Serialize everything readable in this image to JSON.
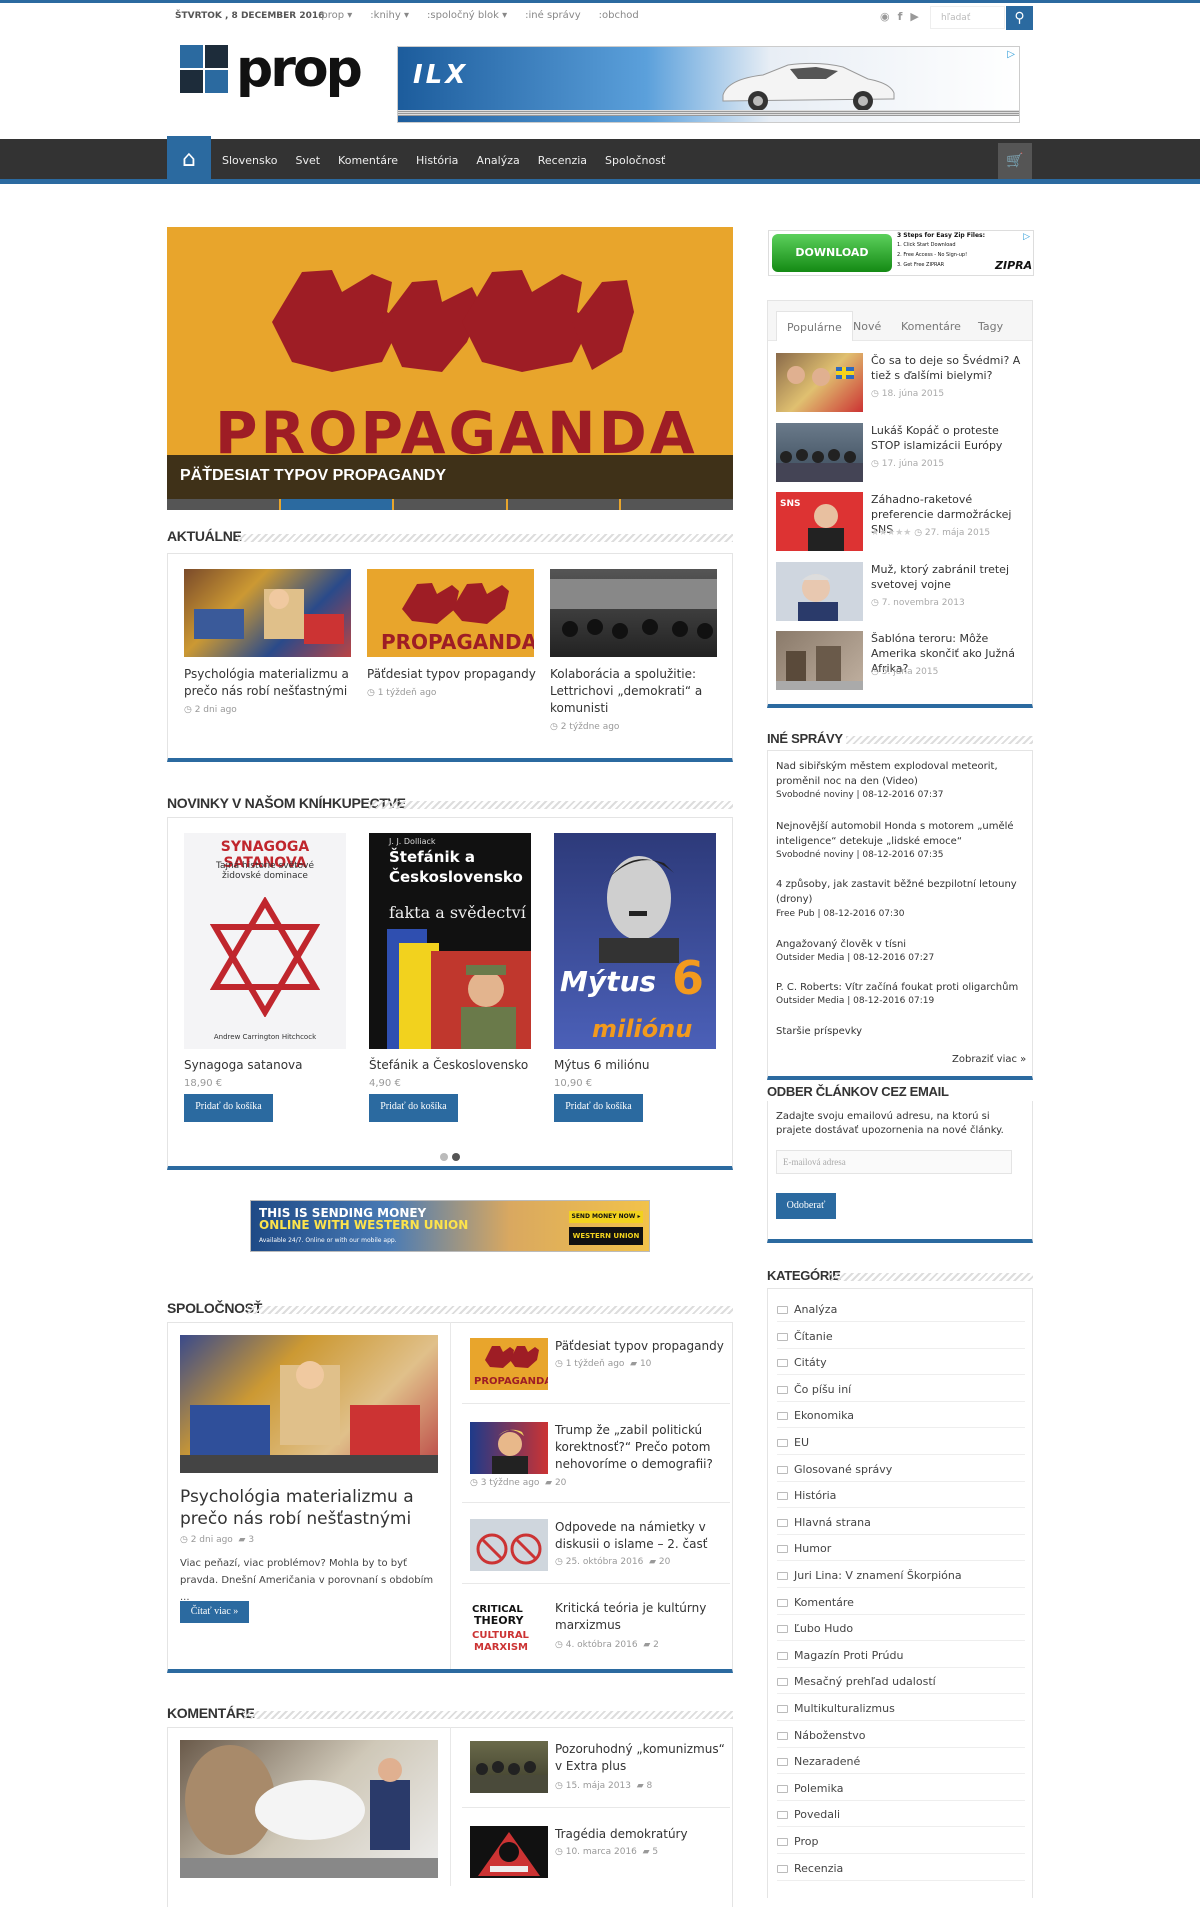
{
  "topbar": {
    "date": "ŠTVRTOK , 8 DECEMBER 2016",
    "menu": [
      ":prop",
      ":knihy",
      ":spoločný blok",
      ":iné správy",
      ":obchod"
    ],
    "search_placeholder": "hľadať"
  },
  "logo": {
    "text": "prop",
    "colors": [
      "#2b6aa0",
      "#1d2c3a",
      "#1d2c3a",
      "#2b6aa0"
    ]
  },
  "ad_top": {
    "text": "ILX"
  },
  "nav": {
    "items": [
      "Slovensko",
      "Svet",
      "Komentáre",
      "História",
      "Analýza",
      "Recenzia",
      "Spoločnosť"
    ]
  },
  "slider": {
    "image_text": "PROPAGANDA",
    "caption": "PÄŤDESIAT TYPOV PROPAGANDY",
    "slides": 5,
    "active": 2
  },
  "aktualne": {
    "title": "AKTUÁLNE",
    "items": [
      {
        "title": "Psychológia materializmu a prečo nás robí nešťastnými",
        "meta": "2 dni ago"
      },
      {
        "title": "Päťdesiat typov propagandy",
        "meta": "1 týždeň ago"
      },
      {
        "title": "Kolaborácia a spolužitie: Lettrichovi „demokrati“ a komunisti",
        "meta": "2 týždne ago"
      }
    ]
  },
  "novinky": {
    "title": "NOVINKY V NAŠOM KNÍHKUPECTVE",
    "button_label": "Pridať do košíka",
    "books": [
      {
        "title": "Synagoga satanova",
        "price": "18,90 €",
        "cover_title": "SYNAGOGA SATANOVA",
        "cover_sub": "Tajná historie světové židovské dominace",
        "cover_author": "Andrew Carrington Hitchcock"
      },
      {
        "title": "Štefánik a Československo",
        "price": "4,90 €",
        "cover_author": "J. J. Dolliack",
        "cover_title": "Štefánik a Československo",
        "cover_sub": "fakta a svědectví"
      },
      {
        "title": "Mýtus 6 miliónu",
        "price": "10,90 €",
        "cover_title": "Mýtus",
        "cover_num": "6",
        "cover_sub": "miliónu"
      }
    ]
  },
  "ad_middle": {
    "line1": "THIS IS SENDING MONEY",
    "line2": "ONLINE WITH WESTERN UNION",
    "line3": "Available 24/7. Online or with our mobile app.",
    "badge": "SEND MONEY NOW ▸",
    "logo": "WESTERN UNION WU"
  },
  "spolocnost": {
    "title": "SPOLOČNOSŤ",
    "main": {
      "title": "Psychológia materializmu a prečo nás robí nešťastnými",
      "meta": "2 dni ago",
      "comments": "3",
      "excerpt": "Viac peňazí, viac problémov? Mohla by to byť pravda. Dnešní Američania v porovnaní s obdobím ...",
      "button": "Čítať viac »"
    },
    "items": [
      {
        "title": "Päťdesiat typov propagandy",
        "meta": "1 týždeň ago",
        "comments": "10"
      },
      {
        "title": "Trump že „zabil politickú korektnosť?“ Prečo potom nehovoríme o demografii?",
        "meta": "3 týždne ago",
        "comments": "20"
      },
      {
        "title": "Odpovede na námietky v diskusii o islame – 2. časť",
        "meta": "25. októbra 2016",
        "comments": "20"
      },
      {
        "title": "Kritická teória je kultúrny marxizmus",
        "meta": "4. októbra 2016",
        "comments": "2"
      }
    ]
  },
  "komentare": {
    "title": "KOMENTÁRE",
    "items": [
      {
        "title": "Pozoruhodný „komunizmus“ v Extra plus",
        "meta": "15. mája 2013",
        "comments": "8"
      },
      {
        "title": "Tragédia demokratúry",
        "meta": "10. marca 2016",
        "comments": "5"
      }
    ]
  },
  "sidebar": {
    "ad": {
      "button": "DOWNLOAD",
      "steps_title": "3 Steps for Easy Zip Files:",
      "step1": "1. Click Start Download",
      "step2": "2. Free Access - No Sign-up!",
      "step3": "3. Get Free ZIPRAR",
      "brand": "ZIPRA"
    },
    "tabs": [
      "Populárne",
      "Nové",
      "Komentáre",
      "Tagy"
    ],
    "popular": [
      {
        "title": "Čo sa to deje so Švédmi? A tiež s ďalšími bielymi?",
        "meta": "18. júna 2015"
      },
      {
        "title": "Lukáš Kopáč o proteste STOP islamizácii Európy",
        "meta": "17. júna 2015"
      },
      {
        "title": "Záhadno-raketové preferencie darmožráckej SNS",
        "meta": "27. mája 2015",
        "stars": "★★★★★"
      },
      {
        "title": "Muž, ktorý zabránil tretej svetovej vojne",
        "meta": "7. novembra 2013"
      },
      {
        "title": "Šablóna teroru: Môže Amerika skončiť ako Južná Afrika?",
        "meta": "5. júna 2015"
      }
    ],
    "ine": {
      "title": "INÉ SPRÁVY",
      "items": [
        {
          "title": "Nad sibiřským městem explodoval meteorit, proměnil noc na den (Video)",
          "source": "Svobodné noviny | 08-12-2016 07:37"
        },
        {
          "title": "Nejnovější automobil Honda s motorem „umělé inteligence“ detekuje „lidské emoce“",
          "source": "Svobodné noviny | 08-12-2016 07:35"
        },
        {
          "title": "4 způsoby, jak zastavit běžné bezpilotní letouny (drony)",
          "source": "Free Pub | 08-12-2016 07:30"
        },
        {
          "title": "Angažovaný člověk v tísni",
          "source": "Outsider Media | 08-12-2016 07:27"
        },
        {
          "title": "P. C. Roberts: Vítr začíná foukat proti oligarchům",
          "source": "Outsider Media | 08-12-2016 07:19"
        }
      ],
      "older": "Staršie príspevky",
      "more": "Zobraziť viac »"
    },
    "email": {
      "title": "ODBER ČLÁNKOV CEZ EMAIL",
      "intro": "Zadajte svoju emailovú adresu, na ktorú si prajete dostávať upozornenia na nové články.",
      "placeholder": "E-mailová adresa",
      "button": "Odoberať"
    },
    "categories": {
      "title": "KATEGÓRIE",
      "items": [
        "Analýza",
        "Čítanie",
        "Citáty",
        "Čo píšu iní",
        "Ekonomika",
        "EU",
        "Glosované správy",
        "História",
        "Hlavná strana",
        "Humor",
        "Juri Lina: V znamení Škorpióna",
        "Komentáre",
        "Ľubo Hudo",
        "Magazín Proti Prúdu",
        "Mesačný prehľad udalostí",
        "Multikulturalizmus",
        "Náboženstvo",
        "Nezaradené",
        "Polemika",
        "Povedali",
        "Prop",
        "Recenzia"
      ]
    }
  },
  "colors": {
    "accent": "#2b6aa0",
    "nav_bg": "#333333",
    "propaganda_orange": "#e8a52c",
    "propaganda_red": "#9e1d25"
  }
}
